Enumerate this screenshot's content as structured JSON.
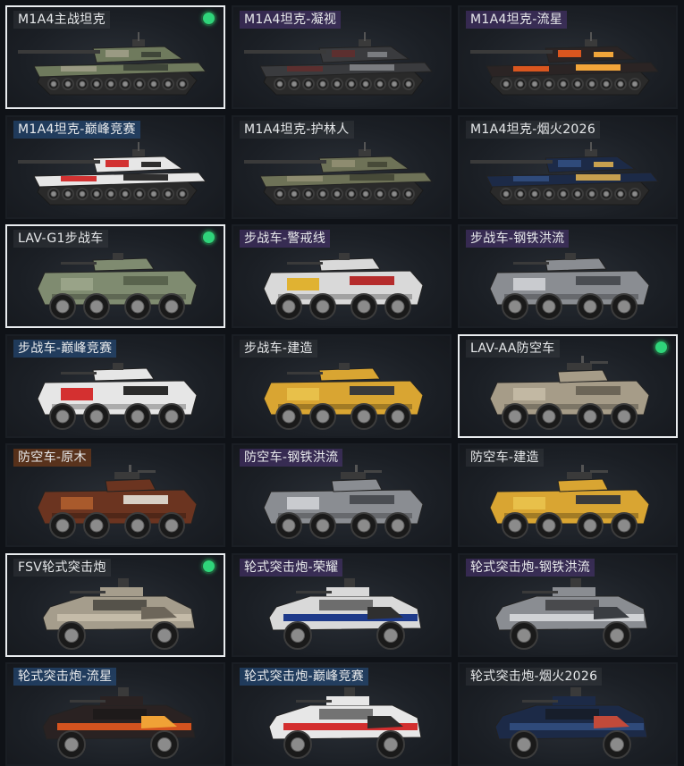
{
  "selected_color": "#2fd47a",
  "items": [
    {
      "label": "M1A4主战坦克",
      "type": "tank",
      "camo": [
        "#6f7a5d",
        "#9a9a83",
        "#3f4639"
      ],
      "selected": true,
      "tint": 0
    },
    {
      "label": "M1A4坦克-凝视",
      "type": "tank",
      "camo": [
        "#3a3b3e",
        "#5c2f2f",
        "#7a7c80"
      ],
      "selected": false,
      "tint": 1
    },
    {
      "label": "M1A4坦克-流星",
      "type": "tank",
      "camo": [
        "#2b2424",
        "#d9561f",
        "#f1a53a"
      ],
      "selected": false,
      "tint": 1
    },
    {
      "label": "M1A4坦克-巅峰竞赛",
      "type": "tank",
      "camo": [
        "#e7e7e7",
        "#d23232",
        "#2e2e2e"
      ],
      "selected": false,
      "tint": 3
    },
    {
      "label": "M1A4坦克-护林人",
      "type": "tank",
      "camo": [
        "#6e7257",
        "#8e8c70",
        "#474a38"
      ],
      "selected": false,
      "tint": 0
    },
    {
      "label": "M1A4坦克-烟火2026",
      "type": "tank",
      "camo": [
        "#1c2a47",
        "#2f4a7a",
        "#c7a04f"
      ],
      "selected": false,
      "tint": 0
    },
    {
      "label": "LAV-G1步战车",
      "type": "ifv",
      "camo": [
        "#7f8b70",
        "#99a388",
        "#59634d"
      ],
      "selected": true,
      "tint": 0
    },
    {
      "label": "步战车-警戒线",
      "type": "ifv",
      "camo": [
        "#d9d9d9",
        "#e0b232",
        "#b52c2c"
      ],
      "selected": false,
      "tint": 1
    },
    {
      "label": "步战车-钢铁洪流",
      "type": "ifv",
      "camo": [
        "#8a8d92",
        "#c9cbcf",
        "#4a4d52"
      ],
      "selected": false,
      "tint": 1
    },
    {
      "label": "步战车-巅峰竞赛",
      "type": "ifv",
      "camo": [
        "#e6e6e6",
        "#d43030",
        "#2b2b2b"
      ],
      "selected": false,
      "tint": 3
    },
    {
      "label": "步战车-建造",
      "type": "ifv",
      "camo": [
        "#d9a532",
        "#e8c04a",
        "#3a3a3a"
      ],
      "selected": false,
      "tint": 0
    },
    {
      "label": "LAV-AA防空车",
      "type": "aa",
      "camo": [
        "#a69c88",
        "#c2b8a3",
        "#6c6557"
      ],
      "selected": true,
      "tint": 0
    },
    {
      "label": "防空车-原木",
      "type": "aa",
      "camo": [
        "#6b3420",
        "#a95a2c",
        "#d8d0c6"
      ],
      "selected": false,
      "tint": 4
    },
    {
      "label": "防空车-钢铁洪流",
      "type": "aa",
      "camo": [
        "#8a8d92",
        "#c9cbcf",
        "#4a4d52"
      ],
      "selected": false,
      "tint": 1
    },
    {
      "label": "防空车-建造",
      "type": "aa",
      "camo": [
        "#d9a532",
        "#e8c04a",
        "#3a3a3a"
      ],
      "selected": false,
      "tint": 0
    },
    {
      "label": "FSV轮式突击炮",
      "type": "fsv",
      "camo": [
        "#a59d8c",
        "#c4bba8",
        "#6d665a"
      ],
      "selected": true,
      "tint": 0
    },
    {
      "label": "轮式突击炮-荣耀",
      "type": "fsv",
      "camo": [
        "#d9d9d9",
        "#1e3a8a",
        "#2f2f2f"
      ],
      "selected": false,
      "tint": 1
    },
    {
      "label": "轮式突击炮-钢铁洪流",
      "type": "fsv",
      "camo": [
        "#8a8d92",
        "#d0d2d5",
        "#3a3d42"
      ],
      "selected": false,
      "tint": 1
    },
    {
      "label": "轮式突击炮-流星",
      "type": "fsv",
      "camo": [
        "#2a2222",
        "#d4531f",
        "#f0a236"
      ],
      "selected": false,
      "tint": 3
    },
    {
      "label": "轮式突击炮-巅峰竞赛",
      "type": "fsv",
      "camo": [
        "#e7e7e7",
        "#d32e2e",
        "#2b2b2b"
      ],
      "selected": false,
      "tint": 3
    },
    {
      "label": "轮式突击炮-烟火2026",
      "type": "fsv",
      "camo": [
        "#1c2a47",
        "#2f4a7a",
        "#c24a3a"
      ],
      "selected": false,
      "tint": 0
    }
  ]
}
